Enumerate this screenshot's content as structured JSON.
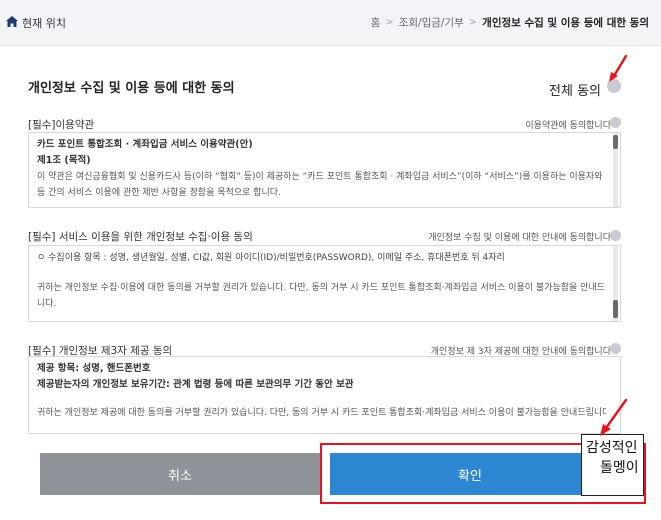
{
  "location": {
    "label": "현재 위치",
    "icon": "home-icon"
  },
  "breadcrumb": [
    "홈",
    "조회/입금/기부",
    "개인정보 수집 및 이용 등에 대한 동의"
  ],
  "page_title": "개인정보 수집 및 이용 등에 대한 동의",
  "all_agree_label": "전체 동의",
  "sections": [
    {
      "title": "[필수]이용약관",
      "agree_label": "이용약관에 동의합니다",
      "lines": [
        {
          "text": "카드 포인트 통합조회 · 계좌입금 서비스 이용약관(안)",
          "bold": true
        },
        {
          "text": "제1조 (목적)",
          "bold": true
        },
        {
          "text": "이 약관은 여신금융협회 및 신용카드사 등(이하 “협회” 등)이 제공하는 “카드 포인트 통합조회 · 계좌입금 서비스”(이하 “서비스”)를 이용하는 이용자와 협회",
          "bold": false
        },
        {
          "text": "등 간의 서비스 이용에 관한 제반 사항을 정함을 목적으로 합니다.",
          "bold": false
        }
      ]
    },
    {
      "title": "[필수] 서비스 이용을 위한 개인정보 수집·이용 동의",
      "agree_label": "개인정보 수집 및 이용에 대한 안내에 동의합니다",
      "lines": [
        {
          "text": "ㅇ 수집이용 항목 : 성명, 생년월일, 성별, CI값, 회원 아이디(ID)/비밀번호(PASSWORD), 이메일 주소, 휴대폰번호 뒤 4자리",
          "bold": false
        },
        {
          "text": "",
          "bold": false
        },
        {
          "text": "귀하는 개인정보 수집·이용에 대한 동의를 거부할 권리가 있습니다. 다만, 동의 거부 시 카드 포인트 통합조회·계좌입금 서비스 이용이 불가능함을 안내드립",
          "bold": false
        },
        {
          "text": "니다.",
          "bold": false
        }
      ]
    },
    {
      "title": "[필수] 개인정보 제3자 제공 동의",
      "agree_label": "개인정보 제 3자 제공에 대한 안내에 동의합니다",
      "lines": [
        {
          "text": "제공 항목: 성명, 핸드폰번호",
          "bold": true
        },
        {
          "text": "제공받는자의 개인정보 보유기간: 관계 법령 등에 따른 보관의무 기간 동안 보관",
          "bold": true
        },
        {
          "text": "",
          "bold": false
        },
        {
          "text": "귀하는 개인정보 제공에 대한 동의를 거부할 권리가 있습니다. 다만, 동의 거부 시 카드 포인트 통합조회·계좌입금 서비스 이용이 불가능함을 안내드립니다.",
          "bold": false
        }
      ]
    }
  ],
  "buttons": {
    "cancel": "취소",
    "confirm": "확인"
  },
  "sticker": {
    "line1": "감성적인",
    "line2": "돌멩이"
  },
  "colors": {
    "confirm": "#2c86d1",
    "cancel": "#8e939a",
    "highlight": "#e8161c",
    "check": "#c9cbd0"
  }
}
